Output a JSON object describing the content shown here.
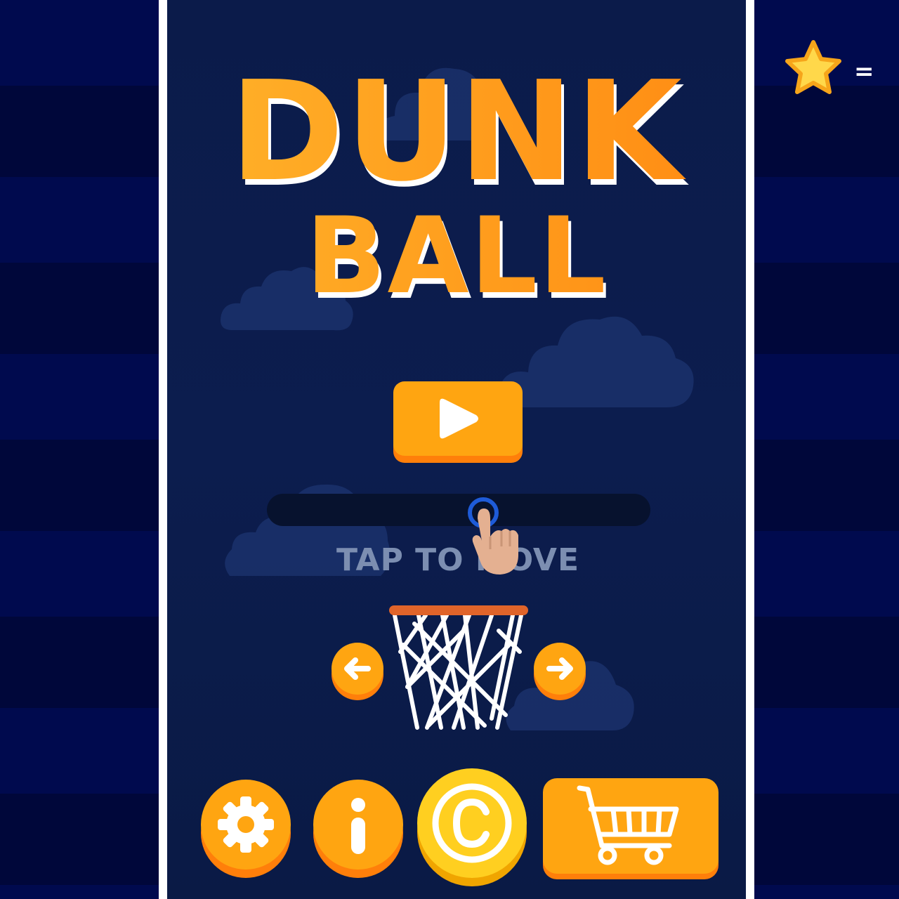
{
  "title": {
    "line1": "DUNK",
    "line2": "BALL"
  },
  "hud": {
    "star_count_text": "="
  },
  "tutorial": {
    "hint": "TAP TO MOVE"
  },
  "buttons": {
    "play": "play-icon",
    "settings": "gear-icon",
    "info": "info-icon",
    "copyright": "copyright-icon",
    "shop": "cart-icon",
    "move_left": "arrow-left-icon",
    "move_right": "arrow-right-icon"
  },
  "colors": {
    "accent_orange": "#ffa511",
    "accent_shadow": "#ff7f0a",
    "gold_coin": "#ffcf20",
    "stage_bg": "#0c1d4e",
    "hint_text": "#7c8eb1"
  }
}
